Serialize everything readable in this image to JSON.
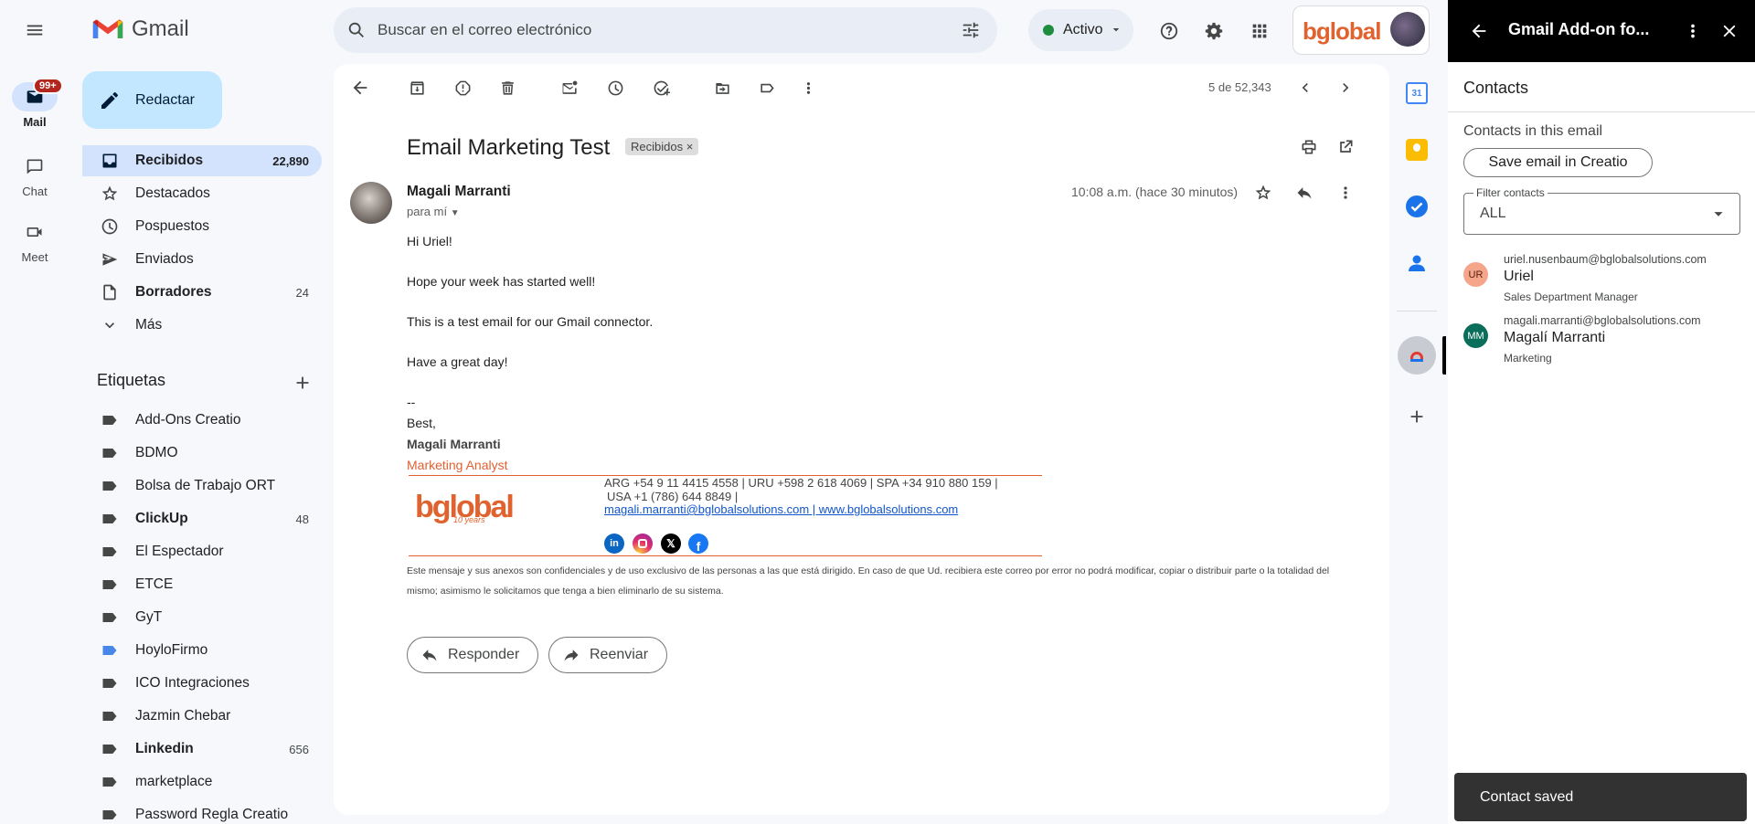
{
  "app": {
    "name": "Gmail"
  },
  "rail": {
    "mail_label": "Mail",
    "mail_badge": "99+",
    "chat_label": "Chat",
    "meet_label": "Meet"
  },
  "search": {
    "placeholder": "Buscar en el correo electrónico"
  },
  "status": {
    "label": "Activo",
    "color": "#1e8e3e"
  },
  "account": {
    "logo_text": "bglobal"
  },
  "compose": {
    "label": "Redactar"
  },
  "nav": [
    {
      "label": "Recibidos",
      "count": "22,890",
      "icon": "inbox-icon"
    },
    {
      "label": "Destacados",
      "count": "",
      "icon": "star-icon"
    },
    {
      "label": "Pospuestos",
      "count": "",
      "icon": "clock-icon"
    },
    {
      "label": "Enviados",
      "count": "",
      "icon": "send-icon"
    },
    {
      "label": "Borradores",
      "count": "24",
      "icon": "draft-icon"
    },
    {
      "label": "Más",
      "count": "",
      "icon": "chevron-down-icon"
    }
  ],
  "labels": {
    "title": "Etiquetas",
    "items": [
      {
        "label": "Add-Ons Creatio",
        "count": ""
      },
      {
        "label": "BDMO",
        "count": ""
      },
      {
        "label": "Bolsa de Trabajo ORT",
        "count": ""
      },
      {
        "label": "ClickUp",
        "count": "48"
      },
      {
        "label": "El Espectador",
        "count": ""
      },
      {
        "label": "ETCE",
        "count": ""
      },
      {
        "label": "GyT",
        "count": ""
      },
      {
        "label": "HoyloFirmo",
        "count": ""
      },
      {
        "label": "ICO Integraciones",
        "count": ""
      },
      {
        "label": "Jazmin Chebar",
        "count": ""
      },
      {
        "label": "Linkedin",
        "count": "656"
      },
      {
        "label": "marketplace",
        "count": ""
      },
      {
        "label": "Password Regla Creatio",
        "count": ""
      }
    ]
  },
  "toolbar": {
    "pagination": "5 de 52,343"
  },
  "email": {
    "subject": "Email Marketing Test",
    "chip": "Recibidos",
    "chip_close": "×",
    "sender": "Magali Marranti",
    "to": "para mí",
    "time": "10:08 a.m. (hace 30 minutos)",
    "greeting": "Hi Uriel!",
    "line1": "Hope your week has started well!",
    "line2": "This is a test email for our Gmail connector.",
    "line3": "Have a great day!",
    "sig_dash": "--",
    "sig_best": "Best,",
    "sig_name": "Magali Marranti",
    "sig_title": "Marketing Analyst",
    "sig_phone1": "ARG +54 9 11 4415 4558 | URU +598 2 618 4069 | SPA +34 910 880 159 |",
    "sig_phone2": "USA +1 (786) 644 8849 |",
    "sig_email": "magali.marranti@bglobalsolutions.com",
    "sig_sep": " | ",
    "sig_web": "www.bglobalsolutions.com",
    "sig_logo": "bglobal",
    "sig_logo_years": "10 years",
    "disclaimer": "Este mensaje y sus anexos son confidenciales y de uso exclusivo de las personas a las que está dirigido. En caso de que Ud. recibiera este correo por error no podrá modificar, copiar o distribuir parte o la totalidad del mismo; asimismo le solicitamos que tenga a bien eliminarlo de su sistema.",
    "reply_label": "Responder",
    "forward_label": "Reenviar"
  },
  "addon": {
    "title": "Gmail Add-on fo...",
    "section": "Contacts",
    "subtitle": "Contacts in this email",
    "save_button": "Save email in Creatio",
    "filter_label": "Filter contacts",
    "filter_value": "ALL",
    "contacts": [
      {
        "initials": "UR",
        "email": "uriel.nusenbaum@bglobalsolutions.com",
        "name": "Uriel",
        "role": "Sales Department Manager",
        "color": "#f4a58a"
      },
      {
        "initials": "MM",
        "email": "magali.marranti@bglobalsolutions.com",
        "name": "Magalí Marranti",
        "role": "Marketing",
        "color": "#0b6e5b"
      }
    ]
  },
  "toast": {
    "message": "Contact saved"
  },
  "colors": {
    "accent": "#c2e7ff",
    "active_nav": "#d3e3fd",
    "signature_orange": "#e06030",
    "badge_red": "#b3261e"
  }
}
